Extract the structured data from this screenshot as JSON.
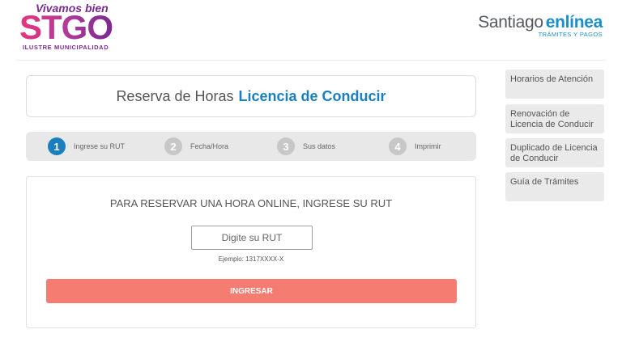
{
  "header": {
    "logo": {
      "tagline": "Vivamos bien",
      "main_text": "STGO",
      "subtitle": "ILUSTRE MUNICIPALIDAD"
    },
    "brand": {
      "name_part1": "Santiago",
      "name_part2": "enlínea",
      "subtitle": "TRÁMITES Y PAGOS"
    }
  },
  "title": {
    "prefix": "Reserva de Horas",
    "highlight": "Licencia de Conducir"
  },
  "steps": [
    {
      "number": "1",
      "label": "Ingrese su RUT",
      "active": true
    },
    {
      "number": "2",
      "label": "Fecha/Hora",
      "active": false
    },
    {
      "number": "3",
      "label": "Sus datos",
      "active": false
    },
    {
      "number": "4",
      "label": "Imprimir",
      "active": false
    }
  ],
  "form": {
    "heading": "PARA RESERVAR UNA HORA ONLINE, INGRESE SU RUT",
    "rut_value": "",
    "rut_placeholder": "Digite su RUT",
    "example": "Ejemplo: 1317XXXX-X",
    "submit_label": "INGRESAR"
  },
  "sidebar": {
    "items": [
      {
        "label": "Horarios de Atención"
      },
      {
        "label": "Renovación de Licencia de Conducir"
      },
      {
        "label": "Duplicado de Licencia de Conducir"
      },
      {
        "label": "Guía de Trámites"
      }
    ]
  },
  "colors": {
    "accent_blue": "#1a7fbf",
    "brand_purple": "#7a2a8f",
    "button_coral": "#f47c70",
    "step_inactive": "#c7c7c7",
    "panel_gray": "#e8e8e8"
  }
}
